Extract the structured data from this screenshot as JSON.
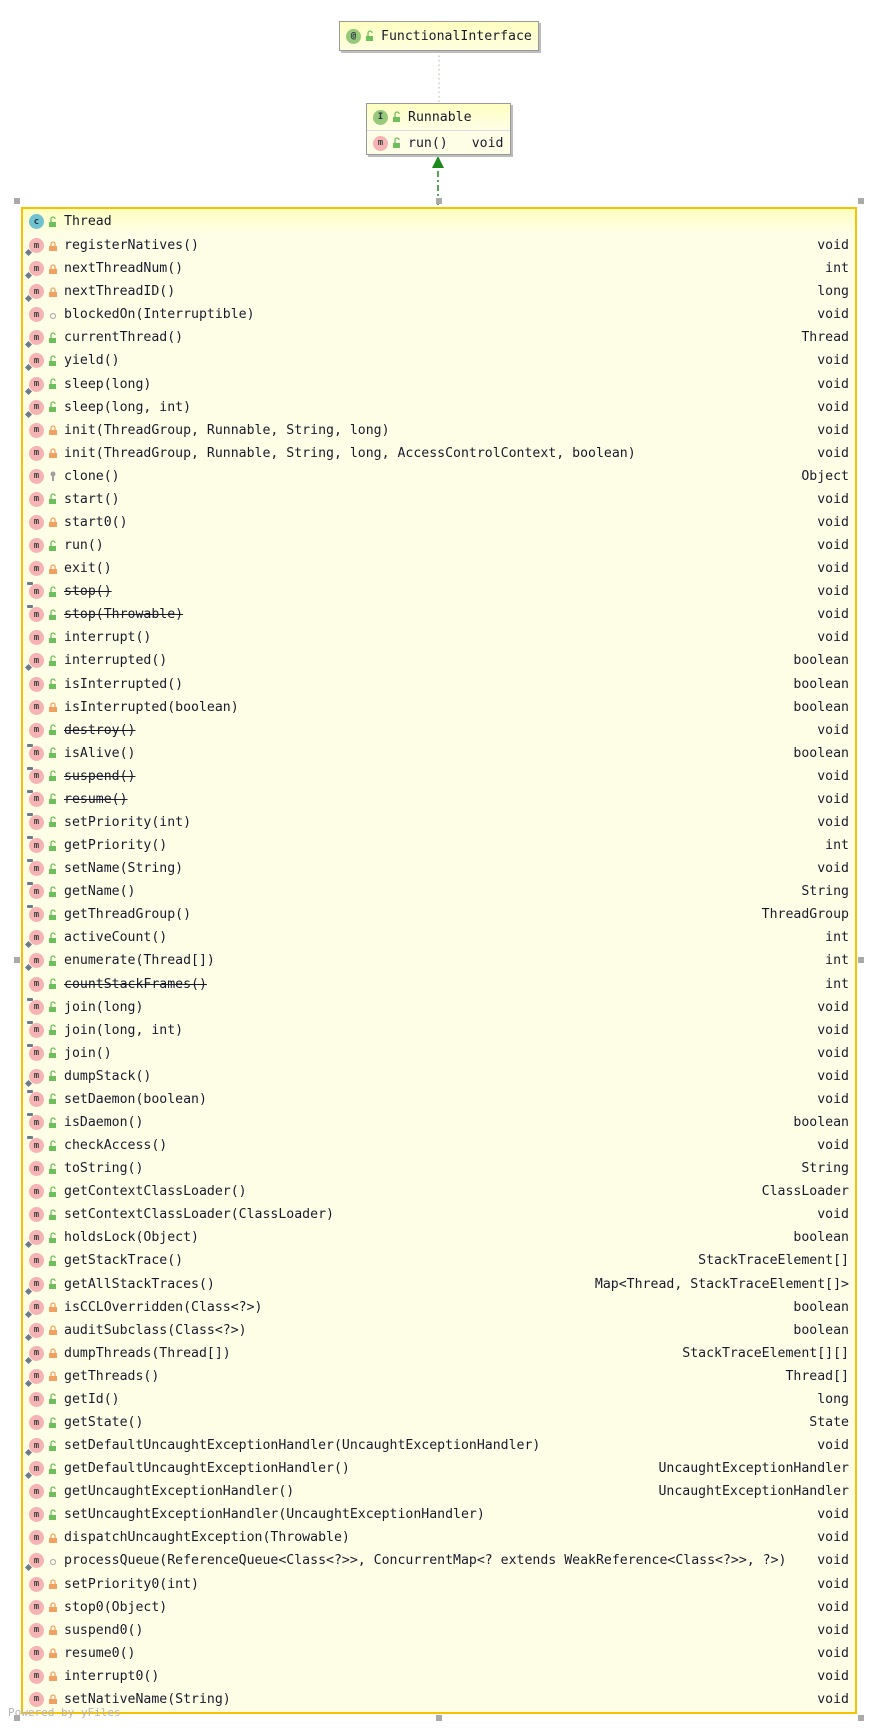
{
  "functional_interface": {
    "name": "FunctionalInterface",
    "kind": "annotation",
    "visibility": "public"
  },
  "runnable": {
    "name": "Runnable",
    "kind": "interface",
    "visibility": "public",
    "methods": [
      {
        "name": "run()",
        "type": "void",
        "visibility": "public"
      }
    ]
  },
  "thread": {
    "name": "Thread",
    "kind": "class",
    "visibility": "public",
    "methods": [
      {
        "name": "registerNatives()",
        "type": "void",
        "visibility": "private",
        "static": true
      },
      {
        "name": "nextThreadNum()",
        "type": "int",
        "visibility": "private",
        "static": true
      },
      {
        "name": "nextThreadID()",
        "type": "long",
        "visibility": "private",
        "static": true
      },
      {
        "name": "blockedOn(Interruptible)",
        "type": "void",
        "visibility": "package"
      },
      {
        "name": "currentThread()",
        "type": "Thread",
        "visibility": "public",
        "static": true
      },
      {
        "name": "yield()",
        "type": "void",
        "visibility": "public",
        "static": true
      },
      {
        "name": "sleep(long)",
        "type": "void",
        "visibility": "public",
        "static": true
      },
      {
        "name": "sleep(long, int)",
        "type": "void",
        "visibility": "public",
        "static": true
      },
      {
        "name": "init(ThreadGroup, Runnable, String, long)",
        "type": "void",
        "visibility": "private"
      },
      {
        "name": "init(ThreadGroup, Runnable, String, long, AccessControlContext, boolean)",
        "type": "void",
        "visibility": "private"
      },
      {
        "name": "clone()",
        "type": "Object",
        "visibility": "protected"
      },
      {
        "name": "start()",
        "type": "void",
        "visibility": "public"
      },
      {
        "name": "start0()",
        "type": "void",
        "visibility": "private"
      },
      {
        "name": "run()",
        "type": "void",
        "visibility": "public"
      },
      {
        "name": "exit()",
        "type": "void",
        "visibility": "private"
      },
      {
        "name": "stop()",
        "type": "void",
        "visibility": "public",
        "final": true,
        "deprecated": true
      },
      {
        "name": "stop(Throwable)",
        "type": "void",
        "visibility": "public",
        "final": true,
        "deprecated": true
      },
      {
        "name": "interrupt()",
        "type": "void",
        "visibility": "public"
      },
      {
        "name": "interrupted()",
        "type": "boolean",
        "visibility": "public",
        "static": true
      },
      {
        "name": "isInterrupted()",
        "type": "boolean",
        "visibility": "public"
      },
      {
        "name": "isInterrupted(boolean)",
        "type": "boolean",
        "visibility": "private"
      },
      {
        "name": "destroy()",
        "type": "void",
        "visibility": "public",
        "deprecated": true
      },
      {
        "name": "isAlive()",
        "type": "boolean",
        "visibility": "public",
        "final": true
      },
      {
        "name": "suspend()",
        "type": "void",
        "visibility": "public",
        "final": true,
        "deprecated": true
      },
      {
        "name": "resume()",
        "type": "void",
        "visibility": "public",
        "final": true,
        "deprecated": true
      },
      {
        "name": "setPriority(int)",
        "type": "void",
        "visibility": "public",
        "final": true
      },
      {
        "name": "getPriority()",
        "type": "int",
        "visibility": "public",
        "final": true
      },
      {
        "name": "setName(String)",
        "type": "void",
        "visibility": "public",
        "final": true
      },
      {
        "name": "getName()",
        "type": "String",
        "visibility": "public",
        "final": true
      },
      {
        "name": "getThreadGroup()",
        "type": "ThreadGroup",
        "visibility": "public",
        "final": true
      },
      {
        "name": "activeCount()",
        "type": "int",
        "visibility": "public",
        "static": true
      },
      {
        "name": "enumerate(Thread[])",
        "type": "int",
        "visibility": "public",
        "static": true
      },
      {
        "name": "countStackFrames()",
        "type": "int",
        "visibility": "public",
        "deprecated": true
      },
      {
        "name": "join(long)",
        "type": "void",
        "visibility": "public",
        "final": true
      },
      {
        "name": "join(long, int)",
        "type": "void",
        "visibility": "public",
        "final": true
      },
      {
        "name": "join()",
        "type": "void",
        "visibility": "public",
        "final": true
      },
      {
        "name": "dumpStack()",
        "type": "void",
        "visibility": "public",
        "static": true
      },
      {
        "name": "setDaemon(boolean)",
        "type": "void",
        "visibility": "public",
        "final": true
      },
      {
        "name": "isDaemon()",
        "type": "boolean",
        "visibility": "public",
        "final": true
      },
      {
        "name": "checkAccess()",
        "type": "void",
        "visibility": "public",
        "final": true
      },
      {
        "name": "toString()",
        "type": "String",
        "visibility": "public"
      },
      {
        "name": "getContextClassLoader()",
        "type": "ClassLoader",
        "visibility": "public"
      },
      {
        "name": "setContextClassLoader(ClassLoader)",
        "type": "void",
        "visibility": "public"
      },
      {
        "name": "holdsLock(Object)",
        "type": "boolean",
        "visibility": "public",
        "static": true
      },
      {
        "name": "getStackTrace()",
        "type": "StackTraceElement[]",
        "visibility": "public"
      },
      {
        "name": "getAllStackTraces()",
        "type": "Map<Thread, StackTraceElement[]>",
        "visibility": "public",
        "static": true
      },
      {
        "name": "isCCLOverridden(Class<?>)",
        "type": "boolean",
        "visibility": "private",
        "static": true
      },
      {
        "name": "auditSubclass(Class<?>)",
        "type": "boolean",
        "visibility": "private",
        "static": true
      },
      {
        "name": "dumpThreads(Thread[])",
        "type": "StackTraceElement[][]",
        "visibility": "private",
        "static": true
      },
      {
        "name": "getThreads()",
        "type": "Thread[]",
        "visibility": "private",
        "static": true
      },
      {
        "name": "getId()",
        "type": "long",
        "visibility": "public"
      },
      {
        "name": "getState()",
        "type": "State",
        "visibility": "public"
      },
      {
        "name": "setDefaultUncaughtExceptionHandler(UncaughtExceptionHandler)",
        "type": "void",
        "visibility": "public",
        "static": true
      },
      {
        "name": "getDefaultUncaughtExceptionHandler()",
        "type": "UncaughtExceptionHandler",
        "visibility": "public",
        "static": true
      },
      {
        "name": "getUncaughtExceptionHandler()",
        "type": "UncaughtExceptionHandler",
        "visibility": "public"
      },
      {
        "name": "setUncaughtExceptionHandler(UncaughtExceptionHandler)",
        "type": "void",
        "visibility": "public"
      },
      {
        "name": "dispatchUncaughtException(Throwable)",
        "type": "void",
        "visibility": "private"
      },
      {
        "name": "processQueue(ReferenceQueue<Class<?>>, ConcurrentMap<? extends WeakReference<Class<?>>, ?>)",
        "type": "void",
        "visibility": "package",
        "static": true
      },
      {
        "name": "setPriority0(int)",
        "type": "void",
        "visibility": "private"
      },
      {
        "name": "stop0(Object)",
        "type": "void",
        "visibility": "private"
      },
      {
        "name": "suspend0()",
        "type": "void",
        "visibility": "private"
      },
      {
        "name": "resume0()",
        "type": "void",
        "visibility": "private"
      },
      {
        "name": "interrupt0()",
        "type": "void",
        "visibility": "private"
      },
      {
        "name": "setNativeName(String)",
        "type": "void",
        "visibility": "private"
      }
    ]
  },
  "edges": [
    {
      "from": "Thread",
      "to": "Runnable",
      "kind": "implements",
      "color": "#1a8a1a"
    },
    {
      "from": "Runnable",
      "to": "FunctionalInterface",
      "kind": "annotation",
      "color": "#b8c8a0"
    }
  ],
  "colors": {
    "selection_border": "#f6c200",
    "node_bg": "#fefee6",
    "method_icon": "#f6b3b3",
    "public": "#6cbf5a",
    "private": "#f0a060",
    "package": "#b0b0b0",
    "protected": "#a0a0a0"
  },
  "watermark": "Powered by yFiles"
}
